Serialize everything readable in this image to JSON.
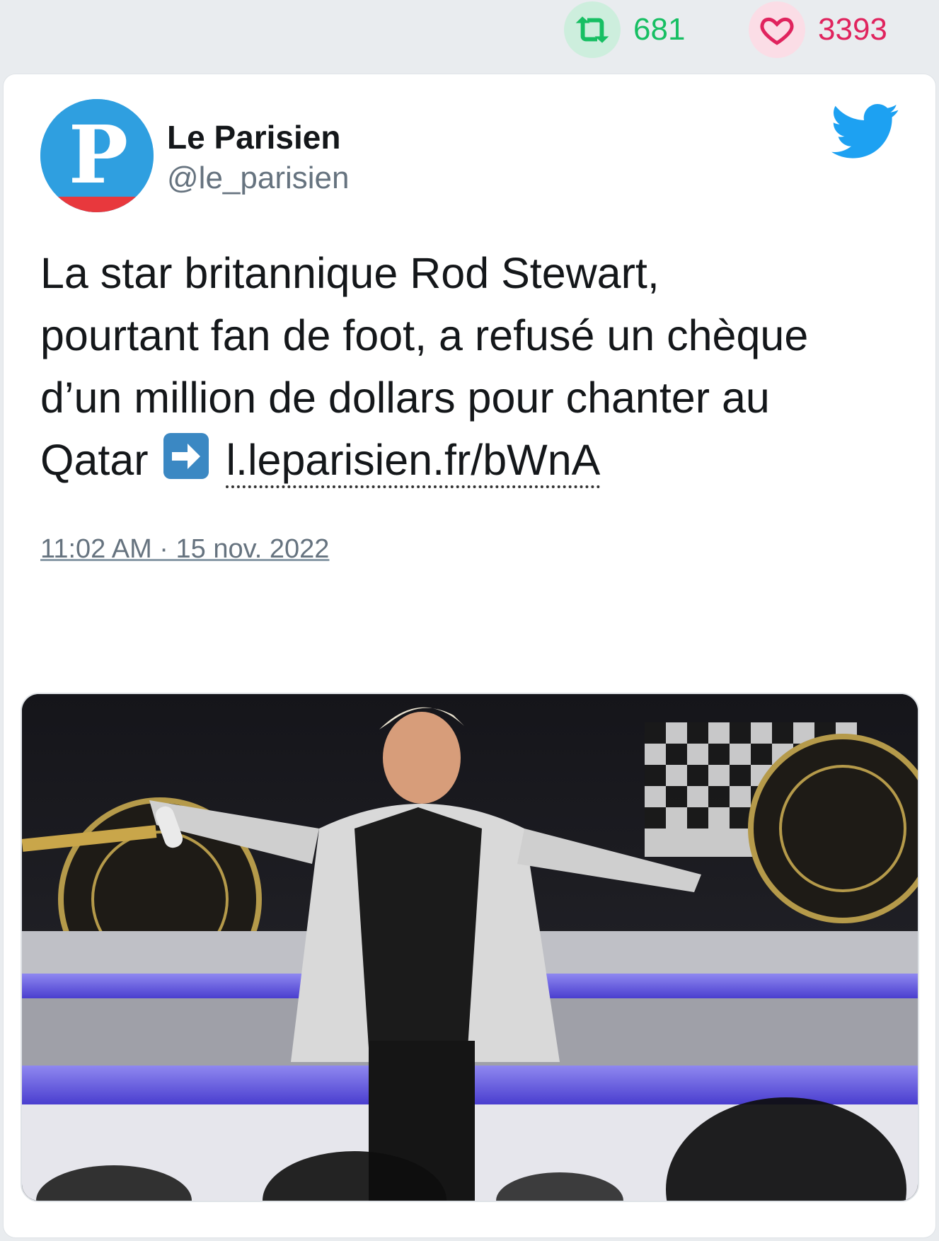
{
  "stats": {
    "retweets": "681",
    "likes": "3393",
    "retweet_icon": "retweet-icon",
    "like_icon": "heart-icon"
  },
  "tweet": {
    "author_name": "Le Parisien",
    "author_handle": "@le_parisien",
    "avatar_letter": "P",
    "text_line1": "La star britannique Rod Stewart,",
    "text_line2": "pourtant fan de foot, a refusé un chèque",
    "text_line3": "d’un million de dollars pour chanter au",
    "text_line4_prefix": "Qatar",
    "emoji": "arrow-right-emoji",
    "link": "l.leparisien.fr/bWnA",
    "timestamp": "11:02 AM · 15 nov. 2022",
    "platform_icon": "twitter-bird-icon"
  },
  "actions": {
    "reply_icon": "reply-icon",
    "retweet_icon": "retweet-icon",
    "like_icon": "heart-icon"
  },
  "media": {
    "description_icon": "photo-image"
  },
  "colors": {
    "retweet_green": "#17bf63",
    "like_pink": "#e0245e",
    "twitter_blue": "#1da1f2",
    "text": "#14171a",
    "muted": "#66737f"
  }
}
